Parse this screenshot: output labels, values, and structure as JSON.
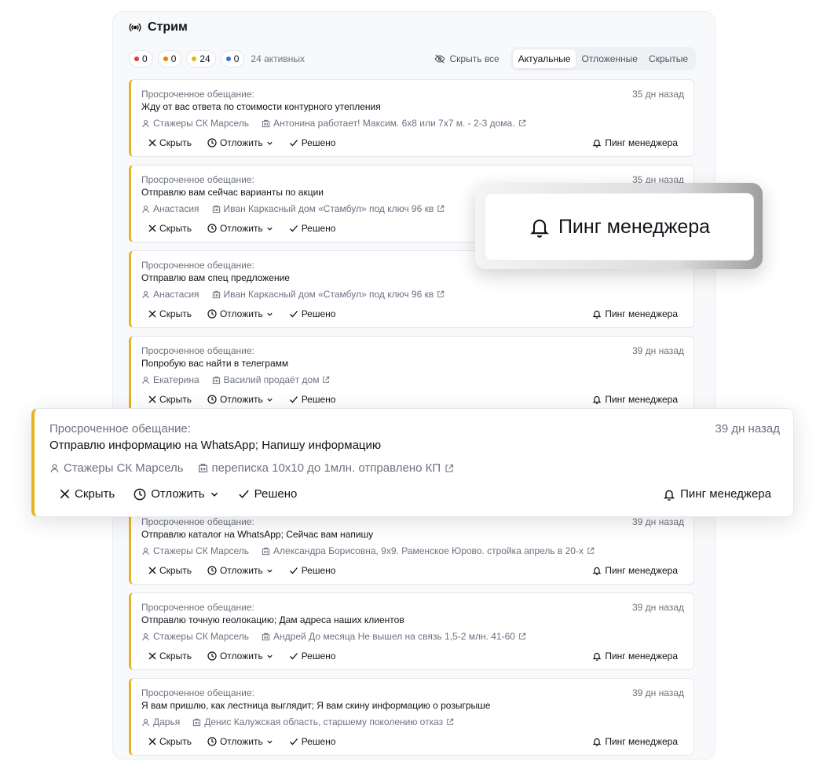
{
  "header": {
    "title": "Стрим"
  },
  "filters": {
    "pills": [
      {
        "color": "#e53935",
        "value": "0"
      },
      {
        "color": "#f57c00",
        "value": "0"
      },
      {
        "color": "#e6b422",
        "value": "24"
      },
      {
        "color": "#3b6fe0",
        "value": "0"
      }
    ],
    "active_count": "24 активных",
    "hide_all": "Скрыть все",
    "tabs": [
      "Актуальные",
      "Отложенные",
      "Скрытые"
    ]
  },
  "actions": {
    "hide": "Скрыть",
    "postpone": "Отложить",
    "done": "Решено",
    "ping": "Пинг менеджера"
  },
  "cards": [
    {
      "label": "Просроченное обещание:",
      "time": "35 дн назад",
      "text": "Жду от вас ответа по стоимости контурного утепления",
      "person": "Стажеры СК Марсель",
      "deal": "Антонина работает! Максим. 6х8 или 7х7 м. - 2-3 дома."
    },
    {
      "label": "Просроченное обещание:",
      "time": "35 дн назад",
      "text": "Отправлю вам сейчас варианты по акции",
      "person": "Анастасия",
      "deal": "Иван Каркасный дом «Стамбул» под ключ 96 кв"
    },
    {
      "label": "Просроченное обещание:",
      "time": "",
      "text": "Отправлю вам спец предложение",
      "person": "Анастасия",
      "deal": "Иван Каркасный дом «Стамбул» под ключ 96 кв"
    },
    {
      "label": "Просроченное обещание:",
      "time": "39 дн назад",
      "text": "Попробую вас найти в телеграмм",
      "person": "Екатерина",
      "deal": "Василий продаёт дом"
    },
    {
      "label": "Просроченное обещание:",
      "time": "39 дн назад",
      "text": "Отправлю каталог на WhatsApp; Сейчас вам напишу",
      "person": "Стажеры СК Марсель",
      "deal": "Александра Борисовна, 9х9. Раменское Юрово. стройка апрель в 20-х"
    },
    {
      "label": "Просроченное обещание:",
      "time": "39 дн назад",
      "text": "Отправлю точную геолокацию; Дам адреса наших клиентов",
      "person": "Стажеры СК Марсель",
      "deal": "Андрей До месяца Не вышел на связь 1,5-2 млн. 41-60"
    },
    {
      "label": "Просроченное обещание:",
      "time": "39 дн назад",
      "text": "Я вам пришлю, как лестница выглядит; Я вам скину информацию о розыгрыше",
      "person": "Дарья",
      "deal": "Денис Калужская область, старшему поколению отказ"
    }
  ],
  "highlight": {
    "label": "Просроченное обещание:",
    "time": "39 дн назад",
    "text": "Отправлю информацию на WhatsApp; Напишу информацию",
    "person": "Стажеры СК Марсель",
    "deal": "переписка 10х10 до 1млн. отправлено КП"
  },
  "popup": {
    "label": "Пинг менеджера"
  }
}
